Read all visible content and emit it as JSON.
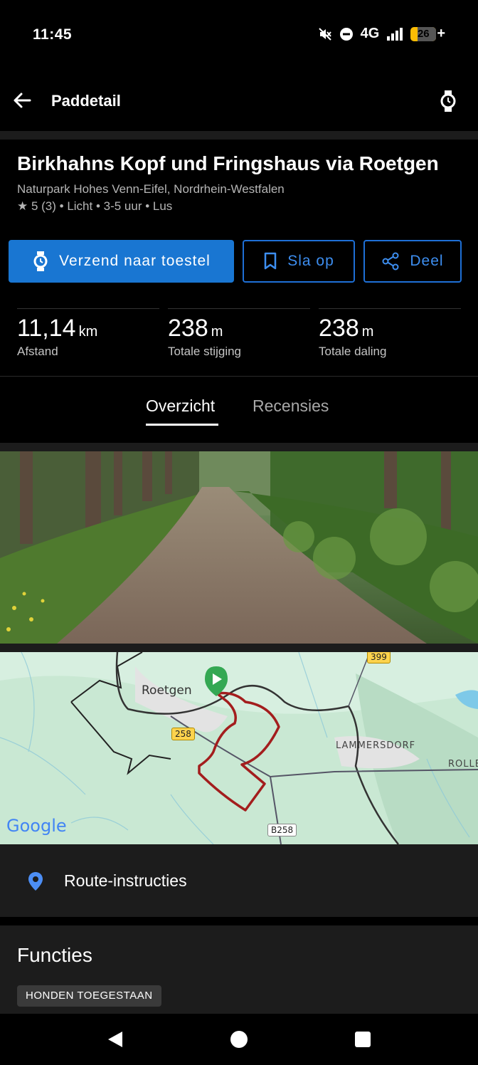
{
  "status": {
    "time": "11:45",
    "network": "4G",
    "battery": "26",
    "battery_suffix": "+"
  },
  "app_bar": {
    "title": "Paddetail"
  },
  "trail": {
    "title": "Birkhahns Kopf und Fringshaus via Roetgen",
    "location": "Naturpark Hohes Venn-Eifel, Nordrhein-Westfalen",
    "meta": "★ 5 (3) • Licht • 3-5 uur • Lus"
  },
  "actions": {
    "send_label": "Verzend naar toestel",
    "save_label": "Sla op",
    "share_label": "Deel"
  },
  "stats": [
    {
      "value": "11,14",
      "unit": "km",
      "label": "Afstand"
    },
    {
      "value": "238",
      "unit": "m",
      "label": "Totale stijging"
    },
    {
      "value": "238",
      "unit": "m",
      "label": "Totale daling"
    }
  ],
  "tabs": [
    {
      "label": "Overzicht",
      "active": true
    },
    {
      "label": "Recensies",
      "active": false
    }
  ],
  "map": {
    "labels": {
      "roetgen": "Roetgen",
      "lammersdorf": "LAMMERSDORF",
      "rolle": "ROLLE",
      "road_399": "399",
      "road_258": "258",
      "road_b258": "B258",
      "google": "Google"
    }
  },
  "route_instructions": {
    "label": "Route-instructies"
  },
  "features": {
    "title": "Functies",
    "chips": [
      "HONDEN TOEGESTAAN"
    ]
  },
  "colors": {
    "accent": "#1976d2",
    "outline": "#1e6fd6",
    "route": "#b71c1c",
    "start_marker": "#34a853"
  }
}
